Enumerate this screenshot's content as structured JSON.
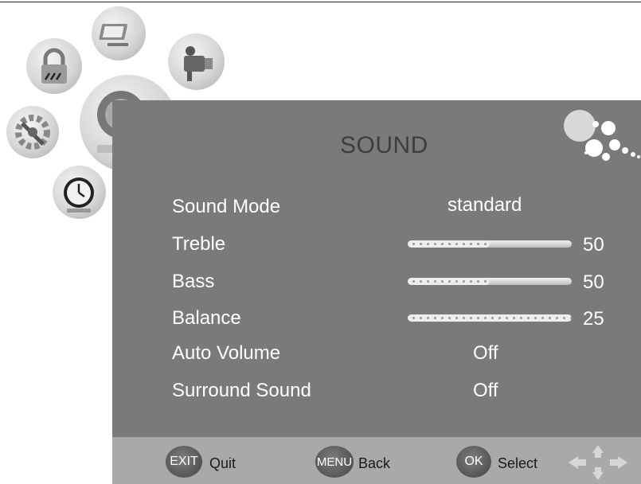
{
  "menu": {
    "title": "SOUND",
    "icons": [
      "picture-icon",
      "lock-icon",
      "camera-icon",
      "sound-icon",
      "setup-icon",
      "time-icon"
    ]
  },
  "items": [
    {
      "label": "Sound Mode",
      "value": "standard"
    },
    {
      "label": "Treble",
      "value": "50",
      "level": 50
    },
    {
      "label": "Bass",
      "value": "50",
      "level": 50
    },
    {
      "label": "Balance",
      "value": "25",
      "level": 100
    },
    {
      "label": "Auto Volume",
      "value": "Off"
    },
    {
      "label": "Surround Sound",
      "value": "Off"
    }
  ],
  "footer": {
    "exit_key": "EXIT",
    "exit_label": "Quit",
    "menu_key": "MENU",
    "menu_label": "Back",
    "ok_key": "OK",
    "ok_label": "Select"
  }
}
